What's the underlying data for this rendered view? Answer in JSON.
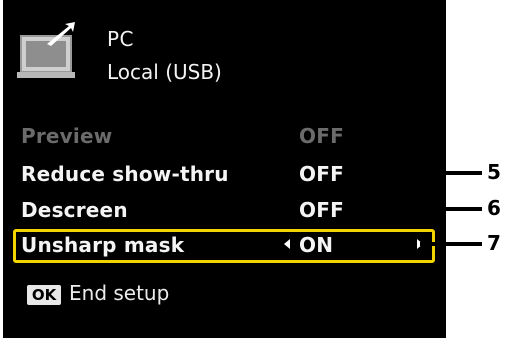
{
  "destination": {
    "icon": "pc-monitor-icon",
    "line1": "PC",
    "line2": "Local (USB)"
  },
  "menu": {
    "items": [
      {
        "label": "Preview",
        "value": "OFF",
        "state": "disabled"
      },
      {
        "label": "Reduce show-thru",
        "value": "OFF",
        "state": "normal"
      },
      {
        "label": "Descreen",
        "value": "OFF",
        "state": "normal"
      },
      {
        "label": "Unsharp mask",
        "value": "ON",
        "state": "selected"
      }
    ]
  },
  "footer": {
    "ok_key": "OK",
    "ok_label": "End setup"
  },
  "callouts": [
    "5",
    "6",
    "7"
  ],
  "colors": {
    "screen_bg": "#000000",
    "selection_frame": "#f2d500",
    "disabled_text": "#6b6b6b"
  }
}
